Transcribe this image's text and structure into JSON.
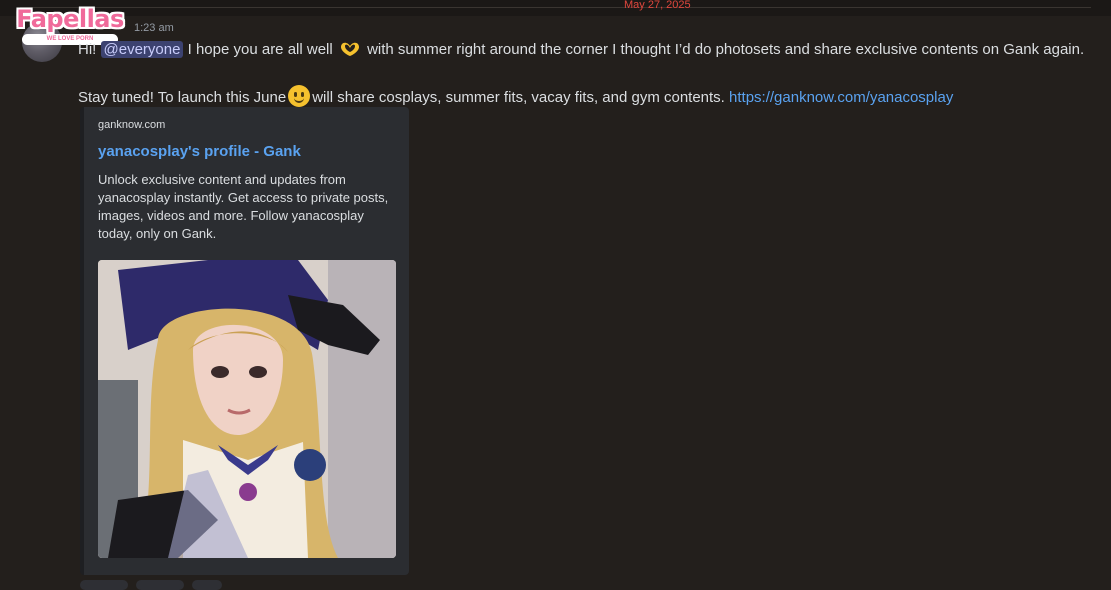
{
  "header": {
    "date_text": "May 27, 2025"
  },
  "logo": {
    "name": "Fapellas",
    "tagline": "WE LOVE PORN"
  },
  "message": {
    "timestamp": "1:23 am",
    "line1": {
      "greeting": "Hi!",
      "mention": "@everyone",
      "text_a": "I hope you are all well",
      "emoji_a": "heart-hands-icon",
      "text_b": "with summer right around the corner I thought I’d do photosets and share exclusive contents on Gank again."
    },
    "line2": {
      "text_a": "Stay tuned! To launch this June",
      "emoji_b": "slightly-smiling-face-icon",
      "text_b": "will share cosplays, summer fits, vacay fits, and gym contents.",
      "link": "https://ganknow.com/yanacosplay"
    }
  },
  "embed": {
    "provider": "ganknow.com",
    "title": "yanacosplay's profile - Gank",
    "description": "Unlock exclusive content and updates from yanacosplay instantly. Get access to private posts, images, videos and more. Follow yanacosplay today, only on Gank."
  },
  "colors": {
    "background": "#231f1c",
    "link": "#5aa2f0",
    "mention_bg": "#3c4270",
    "date_red": "#e0473d"
  }
}
